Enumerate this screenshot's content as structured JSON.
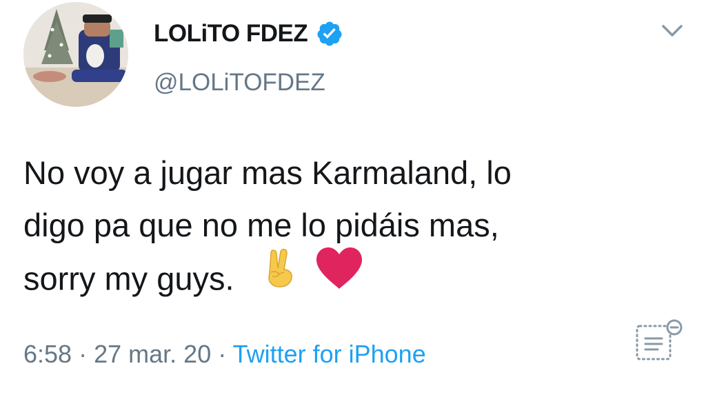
{
  "tweet": {
    "author": {
      "display_name": "LOLiTO FDEZ",
      "handle": "@LOLiTOFDEZ",
      "verified": true
    },
    "text_lines": [
      "No voy a jugar mas Karmaland, lo",
      "digo pa que no me lo pidáis mas,",
      "sorry my guys."
    ],
    "emojis": [
      "victory-hand-icon",
      "red-heart-icon"
    ],
    "time": "6:58",
    "separator": "·",
    "date": "27 mar. 20",
    "source": "Twitter for iPhone"
  },
  "colors": {
    "text": "#14171a",
    "secondary": "#657786",
    "link": "#1da1f2",
    "verified_badge": "#1da1f2",
    "heart": "#e0245e"
  }
}
